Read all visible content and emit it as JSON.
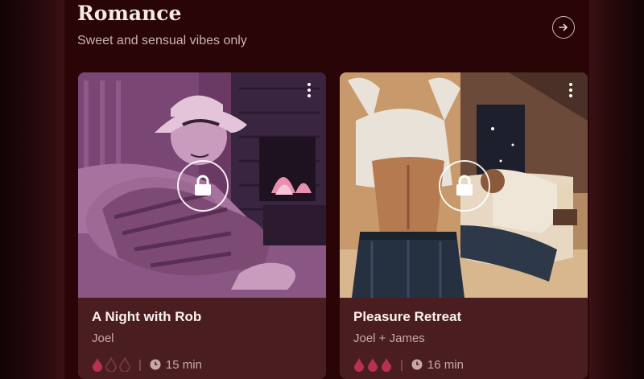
{
  "section": {
    "title": "Romance",
    "subtitle": "Sweet and sensual vibes only"
  },
  "icons": {
    "next": "arrow-right-circle-icon",
    "lock": "lock-icon",
    "menu": "kebab-menu-icon",
    "heat": "flame-drop-icon",
    "duration": "clock-icon"
  },
  "colors": {
    "background": "#2a0508",
    "card": "#4a1e20",
    "heat_active": "#b8314e",
    "heat_inactive": "#7a3a3d"
  },
  "stories": [
    {
      "title": "A Night with Rob",
      "author": "Joel",
      "duration": "15 min",
      "heat_level": 1,
      "heat_max": 3,
      "locked": true
    },
    {
      "title": "Pleasure Retreat",
      "author": "Joel + James",
      "duration": "16 min",
      "heat_level": 3,
      "heat_max": 3,
      "locked": true
    }
  ]
}
